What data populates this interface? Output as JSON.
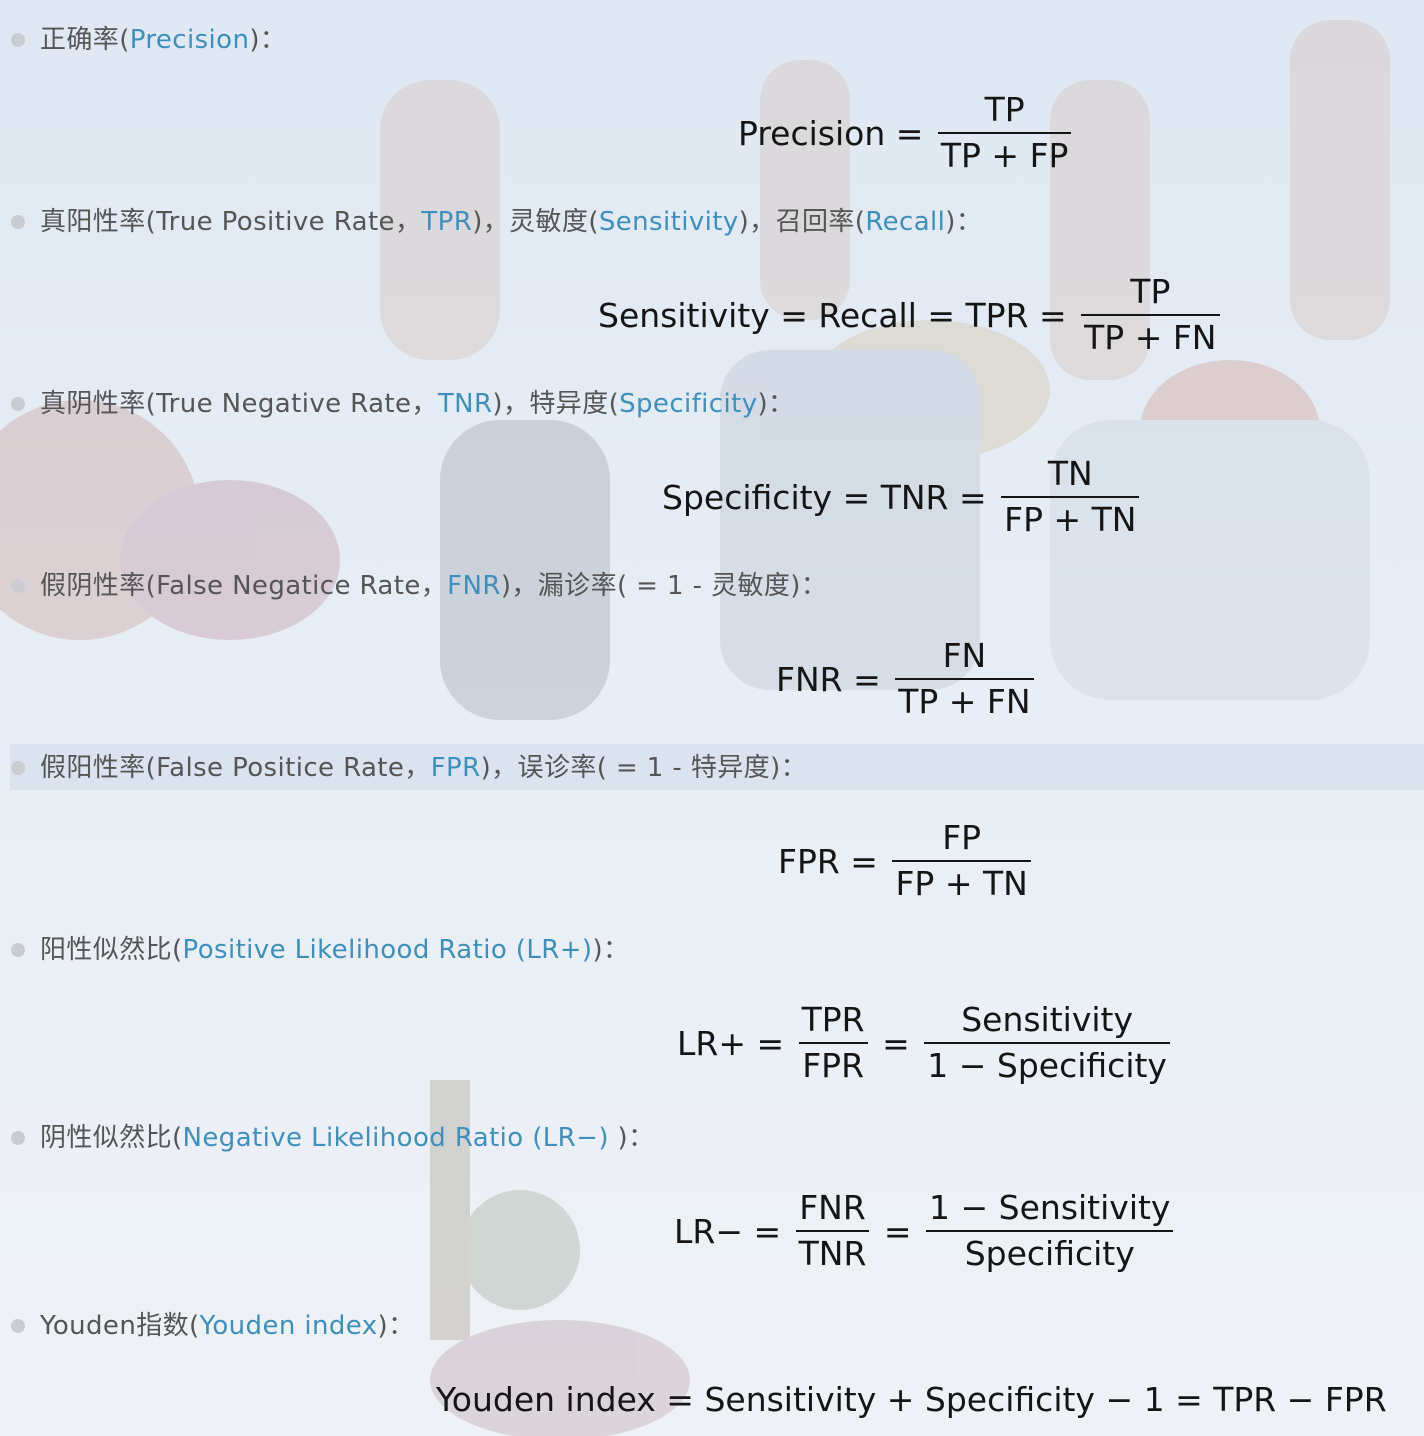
{
  "items": [
    {
      "parts": [
        {
          "t": "正确率(",
          "c": "dark"
        },
        {
          "t": "Precision",
          "c": "link"
        },
        {
          "t": ")：",
          "c": "dark"
        }
      ]
    },
    {
      "parts": [
        {
          "t": "真阳性率(True Positive Rate，",
          "c": "dark"
        },
        {
          "t": "TPR",
          "c": "link"
        },
        {
          "t": ")，灵敏度(",
          "c": "dark"
        },
        {
          "t": "Sensitivity",
          "c": "link"
        },
        {
          "t": ")，召回率(",
          "c": "dark"
        },
        {
          "t": "Recall",
          "c": "link"
        },
        {
          "t": ")：",
          "c": "dark"
        }
      ]
    },
    {
      "parts": [
        {
          "t": "真阴性率(True Negative Rate，",
          "c": "dark"
        },
        {
          "t": "TNR",
          "c": "link"
        },
        {
          "t": ")，特异度(",
          "c": "dark"
        },
        {
          "t": "Specificity",
          "c": "link"
        },
        {
          "t": ")：",
          "c": "dark"
        }
      ]
    },
    {
      "parts": [
        {
          "t": "假阴性率(False Negatice Rate，",
          "c": "dark"
        },
        {
          "t": "FNR",
          "c": "link"
        },
        {
          "t": ")，漏诊率( = 1 - 灵敏度)：",
          "c": "dark"
        }
      ]
    },
    {
      "parts": [
        {
          "t": "假阳性率(False Positice Rate，",
          "c": "dark"
        },
        {
          "t": "FPR",
          "c": "link"
        },
        {
          "t": ")，误诊率( = 1 - 特异度)：",
          "c": "dark"
        }
      ]
    },
    {
      "parts": [
        {
          "t": "阳性似然比(",
          "c": "dark"
        },
        {
          "t": "Positive Likelihood Ratio (LR+)",
          "c": "link"
        },
        {
          "t": ")：",
          "c": "dark"
        }
      ]
    },
    {
      "parts": [
        {
          "t": "阴性似然比(",
          "c": "dark"
        },
        {
          "t": "Negative Likelihood Ratio (LR−) ",
          "c": "link"
        },
        {
          "t": ")：",
          "c": "dark"
        }
      ]
    },
    {
      "parts": [
        {
          "t": "Youden指数(",
          "c": "dark"
        },
        {
          "t": "Youden index",
          "c": "link"
        },
        {
          "t": ")：",
          "c": "dark"
        }
      ]
    }
  ],
  "formulas": [
    {
      "tokens": [
        {
          "t": "Precision = "
        },
        {
          "num": "TP",
          "den": "TP + FP"
        }
      ]
    },
    {
      "tokens": [
        {
          "t": "Sensitivity = Recall = TPR = "
        },
        {
          "num": "TP",
          "den": "TP + FN"
        }
      ]
    },
    {
      "tokens": [
        {
          "t": "Specificity = TNR = "
        },
        {
          "num": "TN",
          "den": "FP + TN"
        }
      ]
    },
    {
      "tokens": [
        {
          "t": "FNR = "
        },
        {
          "num": "FN",
          "den": "TP + FN"
        }
      ]
    },
    {
      "tokens": [
        {
          "t": "FPR = "
        },
        {
          "num": "FP",
          "den": "FP + TN"
        }
      ]
    },
    {
      "tokens": [
        {
          "t": "LR+ = "
        },
        {
          "num": "TPR",
          "den": "FPR"
        },
        {
          "t": " = "
        },
        {
          "num": "Sensitivity",
          "den": "1 − Specificity"
        }
      ]
    },
    {
      "tokens": [
        {
          "t": "LR− = "
        },
        {
          "num": "FNR",
          "den": "TNR"
        },
        {
          "t": " = "
        },
        {
          "num": "1 − Sensitivity",
          "den": "Specificity"
        }
      ]
    },
    {
      "tokens": [
        {
          "t": "Youden index = Sensitivity + Specificity − 1 = TPR − FPR"
        }
      ]
    }
  ],
  "colors": {
    "text": "#555555",
    "link": "#3f8fbd",
    "bullet": "#c9cdd2",
    "formula": "#151515",
    "highlight": "#cddbea"
  }
}
